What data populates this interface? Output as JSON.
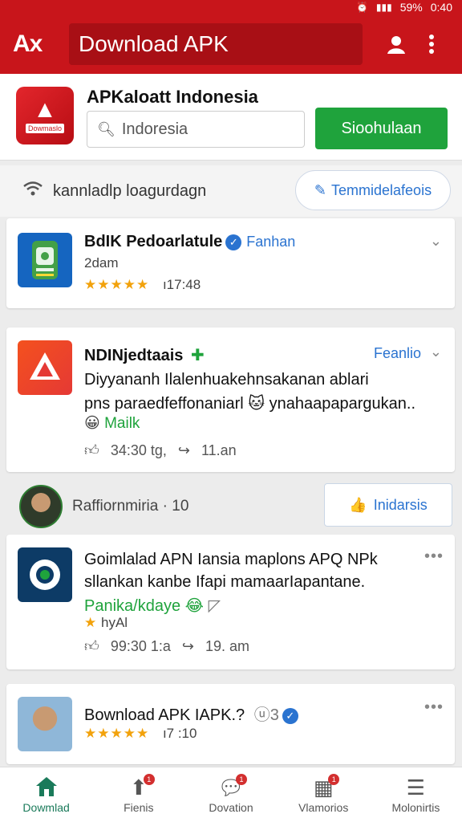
{
  "status_bar": {
    "battery": "59%",
    "time": "0:40"
  },
  "app_bar": {
    "logo": "Ax",
    "title": "Download APK"
  },
  "header": {
    "brand_name": "APKaloatt Indonesia",
    "search_value": "Indoresia",
    "download_button": "Sioohulaan",
    "logo_label": "Dowmaslo"
  },
  "toolbar": {
    "label": "kannladlp loagurdagn",
    "button": "Temmidelafeois"
  },
  "cards": [
    {
      "title": "BdIK Pedoarlatule",
      "tag": "Fanhan",
      "meta": "2dam",
      "stars": "★★★★★",
      "stat": "ı17:48"
    },
    {
      "title": "NDINjedtaais",
      "tag": "Feanlio",
      "desc1": "Diyyananh Ilalenhuakehnsakanan ablari",
      "desc2": "pns paraedfeffonaniarl 🐱 ynahaapapargukan..",
      "reaction": "Mailk",
      "likes": "34:30 tg,",
      "time": "11.an"
    },
    {
      "title": "Goimlalad APN Iansia maplons APQ NPk",
      "desc1": "sllankan kanbe Ifapi mamaarIapantane.",
      "desc2": "Panika/kdaye 😂",
      "rating_text": "hyAl",
      "likes": "99:30 1:a",
      "time": "19. am"
    },
    {
      "title": "Bownload APK IAPK.?",
      "badge_text": "ⓤ3",
      "stars": "★★★★★",
      "stat": "ı7 :10"
    }
  ],
  "profile": {
    "name": "Raffiornmiria",
    "count": "· 10",
    "button": "Inidarsis"
  },
  "bottom_nav": [
    {
      "label": "Dowmlad",
      "icon": "home-icon",
      "badge": ""
    },
    {
      "label": "Fienis",
      "icon": "trending-icon",
      "badge": "1"
    },
    {
      "label": "Dovation",
      "icon": "chat-icon",
      "badge": "1"
    },
    {
      "label": "Vlamorios",
      "icon": "grid-icon",
      "badge": "1"
    },
    {
      "label": "Molonirtis",
      "icon": "menu-icon",
      "badge": ""
    }
  ],
  "colors": {
    "brand_red": "#c8151b",
    "accent_green": "#1fa33c",
    "link_blue": "#2a73d0",
    "star": "#f2a20c"
  }
}
